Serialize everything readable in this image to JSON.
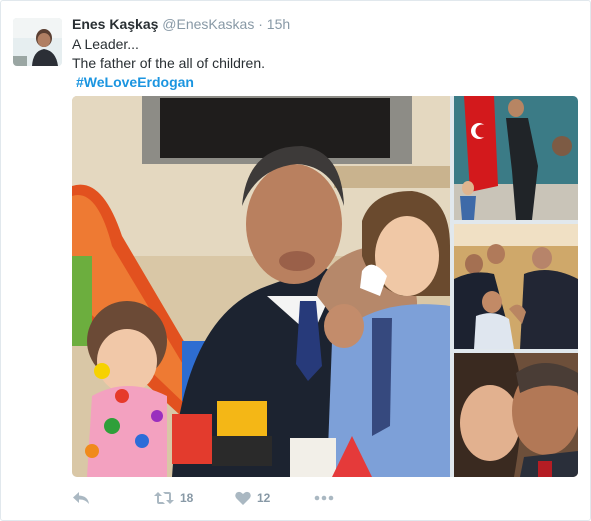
{
  "tweet": {
    "display_name": "Enes Kaşkaş",
    "handle": "@EnesKaskas",
    "separator": "·",
    "time": "15h",
    "lines": [
      "A Leader...",
      "The father of the all of children."
    ],
    "hashtag": "#WeLoveErdogan"
  },
  "actions": {
    "retweet_count": "18",
    "like_count": "12"
  },
  "colors": {
    "text": "#292f33",
    "muted": "#8899a6",
    "link": "#1b95e0",
    "border": "#e1e8ed"
  },
  "icons": {
    "reply": "reply-icon",
    "retweet": "retweet-icon",
    "like": "heart-icon",
    "more": "more-dots-icon"
  }
}
